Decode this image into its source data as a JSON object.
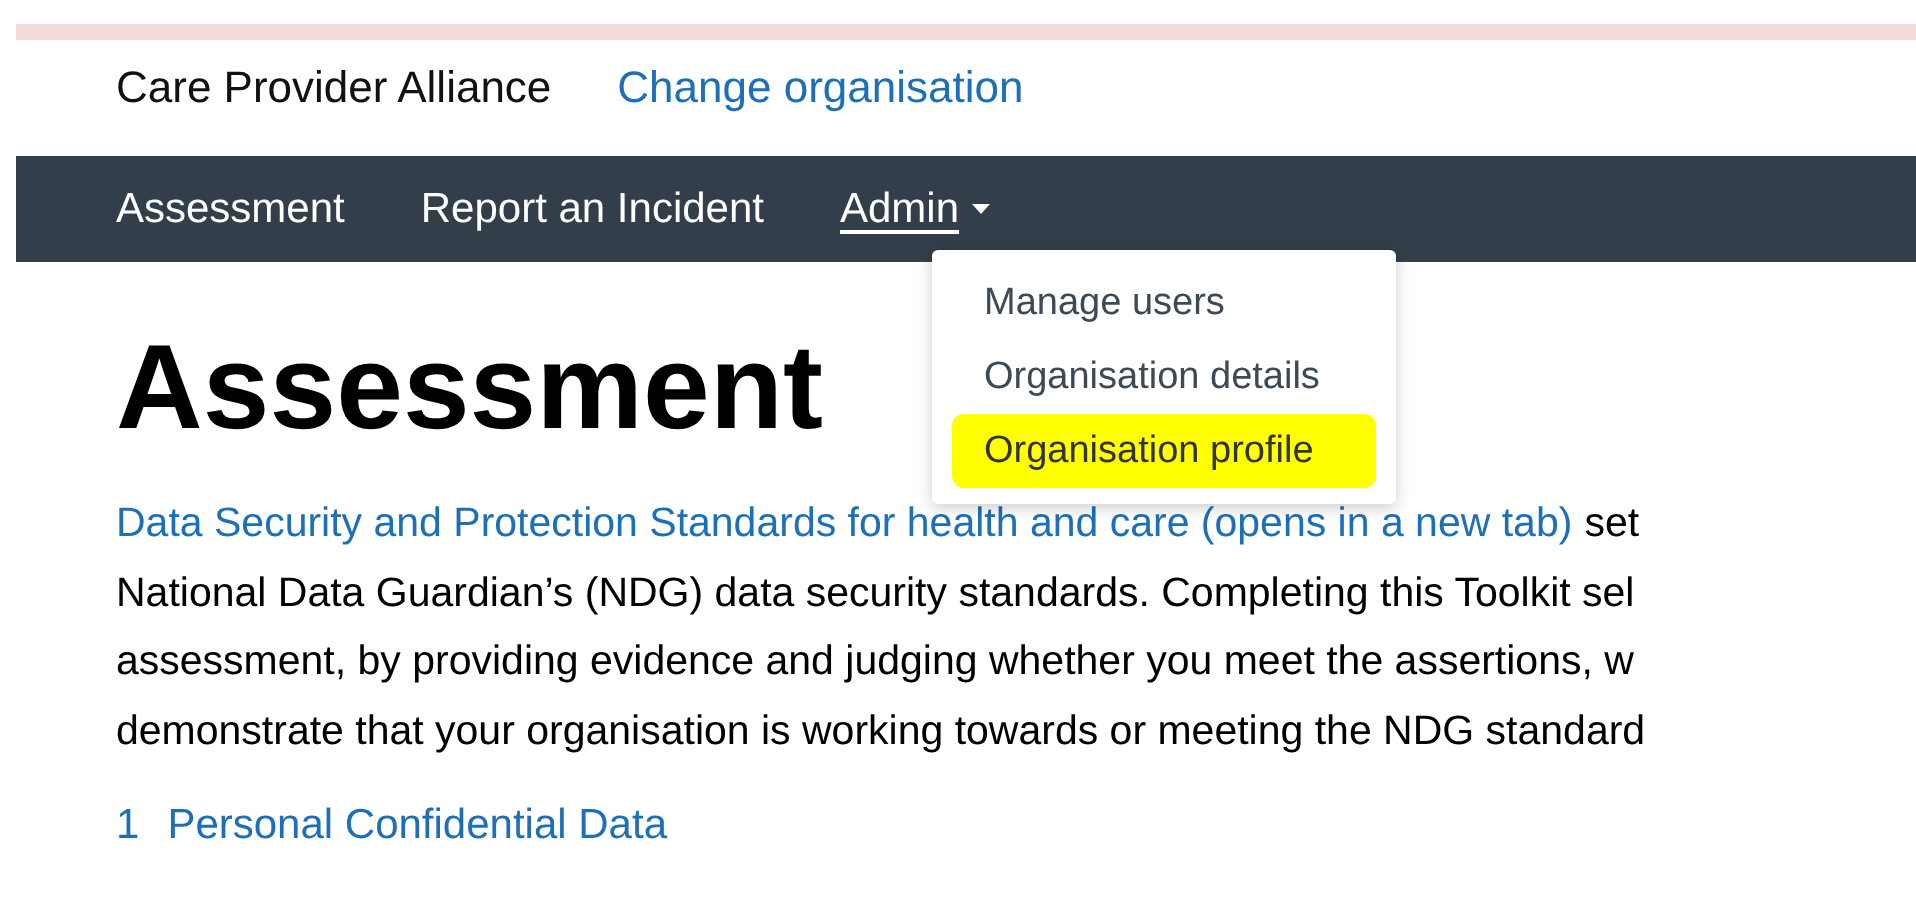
{
  "header": {
    "organisation": "Care Provider Alliance",
    "change_link": "Change organisation"
  },
  "nav": {
    "items": [
      {
        "label": "Assessment",
        "kind": "link"
      },
      {
        "label": "Report an Incident",
        "kind": "link"
      },
      {
        "label": "Admin",
        "kind": "dropdown",
        "expanded": true
      }
    ],
    "menu": [
      {
        "label": "Manage users",
        "selected": false
      },
      {
        "label": "Organisation details",
        "selected": false
      },
      {
        "label": "Organisation profile",
        "selected": true
      }
    ]
  },
  "heading": "Assessment",
  "intro": {
    "link": "Data Security and Protection Standards for health and care (opens in a new tab)",
    "link_tail": "set",
    "lines": [
      "National Data Guardian’s (NDG) data security standards. Completing this Toolkit sel",
      "assessment, by providing evidence and judging whether you meet the assertions, w",
      "demonstrate that your organisation is working towards or meeting the NDG standard"
    ]
  },
  "sections": [
    {
      "number": "1",
      "title": "Personal Confidential Data"
    }
  ]
}
